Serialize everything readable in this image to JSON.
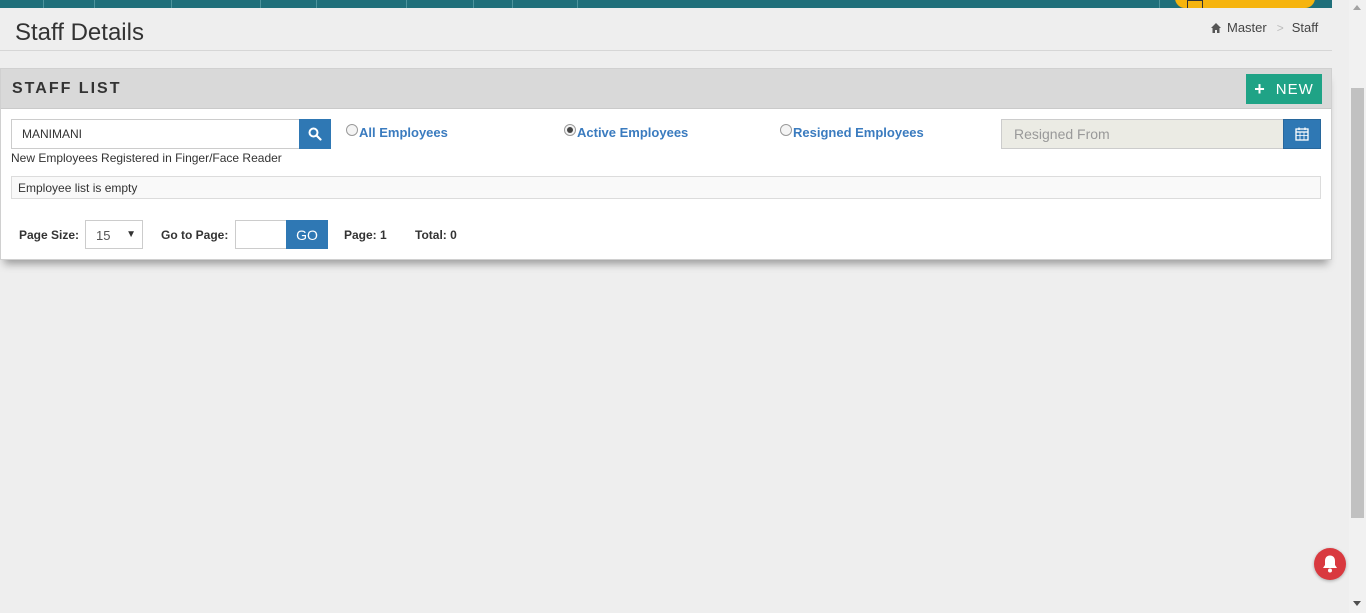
{
  "header": {
    "title": "Staff Details",
    "breadcrumb": [
      {
        "label": "Master",
        "icon": "home-icon"
      },
      {
        "label": "Staff"
      }
    ]
  },
  "panel": {
    "title": "STAFF LIST",
    "new_button": "NEW",
    "search": {
      "value": "MANIMANI",
      "icon": "search-icon"
    },
    "registered_note": "New Employees Registered in Finger/Face Reader",
    "filters": [
      {
        "label": "All Employees",
        "selected": false
      },
      {
        "label": "Active Employees",
        "selected": true
      },
      {
        "label": "Resigned Employees",
        "selected": false
      }
    ],
    "resigned_from": {
      "placeholder": "Resigned From",
      "icon": "calendar-icon"
    },
    "empty_message": "Employee list is empty"
  },
  "pager": {
    "page_size_label": "Page Size:",
    "page_size_value": "15",
    "goto_label": "Go to Page:",
    "go_button": "GO",
    "page_text": "Page: 1",
    "total_text": "Total: 0"
  },
  "colors": {
    "nav": "#1f6f7a",
    "primary": "#2f78b4",
    "success": "#1fa386",
    "alert": "#d9393f",
    "accent": "#f6b40e"
  }
}
